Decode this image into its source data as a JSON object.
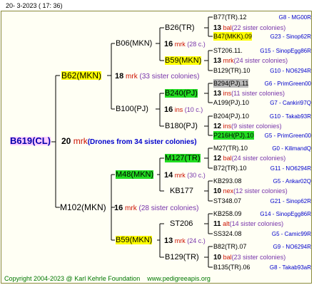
{
  "header": {
    "date": "20-   3-2023 (  17:  36)"
  },
  "footer": {
    "copyright": "Copyright 2004-2023 @ Karl Kehrle Foundation",
    "site": "www.pedigreeapis.org"
  },
  "root": {
    "name": "B619(CL)",
    "num": "20",
    "mark": "mrk",
    "drones": "(Drones from 34 sister colonies)"
  },
  "sire": {
    "name": "B62(MKN)",
    "num": "18",
    "mark": "mrk",
    "sisters": "(33 sister colonies)"
  },
  "dam": {
    "name": "M102(MKN)",
    "num": "16",
    "mark": "mrk",
    "sisters": "(28 sister colonies)"
  },
  "gen3": [
    {
      "name": "B06(MKN)",
      "num": "16",
      "mark": "mrk",
      "sisters": "(28 c.)"
    },
    {
      "name": "B100(PJ)",
      "num": "16",
      "mark": "ins",
      "sisters": "(10 c.)"
    },
    {
      "name": "M48(MKN)",
      "num": "14",
      "mark": "mrk",
      "sisters": "(30 c.)"
    },
    {
      "name": "B59(MKN)",
      "num": "13",
      "mark": "mrk",
      "sisters": "(24 c.)"
    }
  ],
  "gen4": [
    {
      "name": "B26(TR)",
      "num": "13",
      "mark": "bal",
      "sisters": "(22 sister colonies)"
    },
    {
      "name": "B59(MKN)",
      "num": "13",
      "mark": "mrk",
      "sisters": "(24 sister colonies)"
    },
    {
      "name": "B240(PJ)",
      "num": "13",
      "mark": "ins",
      "sisters": "(11 sister colonies)"
    },
    {
      "name": "B180(PJ)",
      "num": "12",
      "mark": "ins",
      "sisters": "(9 sister colonies)"
    },
    {
      "name": "M127(TR)",
      "num": "12",
      "mark": "bal",
      "sisters": "(24 sister colonies)"
    },
    {
      "name": "KB177",
      "num": "10",
      "mark": "nex",
      "sisters": "(12 sister colonies)"
    },
    {
      "name": "ST206",
      "num": "11",
      "mark": "alt",
      "sisters": "(14 sister colonies)"
    },
    {
      "name": "B129(TR)",
      "num": "10",
      "mark": "bal",
      "sisters": "(23 sister colonies)"
    }
  ],
  "leaves": [
    {
      "name": "B77(TR).12",
      "ref": "G8 - MG00R"
    },
    {
      "name": "B47(MKK).09",
      "ref": "G23 - Sinop62R"
    },
    {
      "name": "ST206.11.",
      "ref": "G15 - SinopEgg86R"
    },
    {
      "name": "B129(TR).10",
      "ref": "G10 - NO6294R"
    },
    {
      "name": "B294(PJ).11",
      "ref": "G6 - PrimGreen00"
    },
    {
      "name": "A199(PJ).10",
      "ref": "G7 - Cankiri97Q"
    },
    {
      "name": "B204(PJ).10",
      "ref": "G10 - Takab93R"
    },
    {
      "name": "P216H(PJ).10",
      "ref": "G5 - PrimGreen00"
    },
    {
      "name": "M27(TR).10",
      "ref": "G0 - KilimandQ"
    },
    {
      "name": "B72(TR).10",
      "ref": "G11 - NO6294R"
    },
    {
      "name": "KB293.08",
      "ref": "G5 - Ankar02Q"
    },
    {
      "name": "ST348.07",
      "ref": "G21 - Sinop62R"
    },
    {
      "name": "KB258.09",
      "ref": "G14 - SinopEgg86R"
    },
    {
      "name": "SS324.08",
      "ref": "G5 - Camic99R"
    },
    {
      "name": "B82(TR).07",
      "ref": "G9 - NO6294R"
    },
    {
      "name": "B135(TR).06",
      "ref": "G8 - Takab93aR"
    }
  ]
}
